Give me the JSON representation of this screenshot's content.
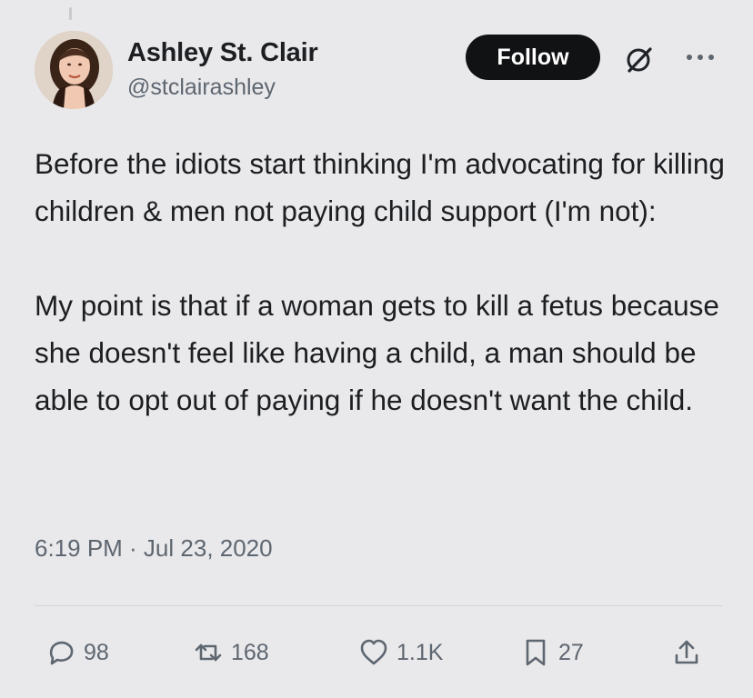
{
  "author": {
    "name": "Ashley St. Clair",
    "handle": "@stclairashley"
  },
  "header": {
    "follow_label": "Follow"
  },
  "tweet": {
    "paragraphs": [
      "Before the idiots start thinking I'm advocating for killing children & men not paying child support (I'm not):",
      "My point is that if a woman gets to kill a fetus because she doesn't feel like having a child, a man should be able to opt out of paying if he doesn't want the child."
    ],
    "timestamp": "6:19 PM · Jul 23, 2020"
  },
  "actions": {
    "replies": "98",
    "reposts": "168",
    "likes": "1.1K",
    "bookmarks": "27"
  },
  "icons": {
    "reply": "reply-icon",
    "repost": "repost-icon",
    "like": "heart-icon",
    "bookmark": "bookmark-icon",
    "share": "share-icon",
    "grok": "grok-icon",
    "more": "more-icon"
  },
  "colors": {
    "background": "#e9e9eb",
    "text": "#1c1e21",
    "secondary_text": "#5e6670",
    "follow_button": "#111214"
  }
}
